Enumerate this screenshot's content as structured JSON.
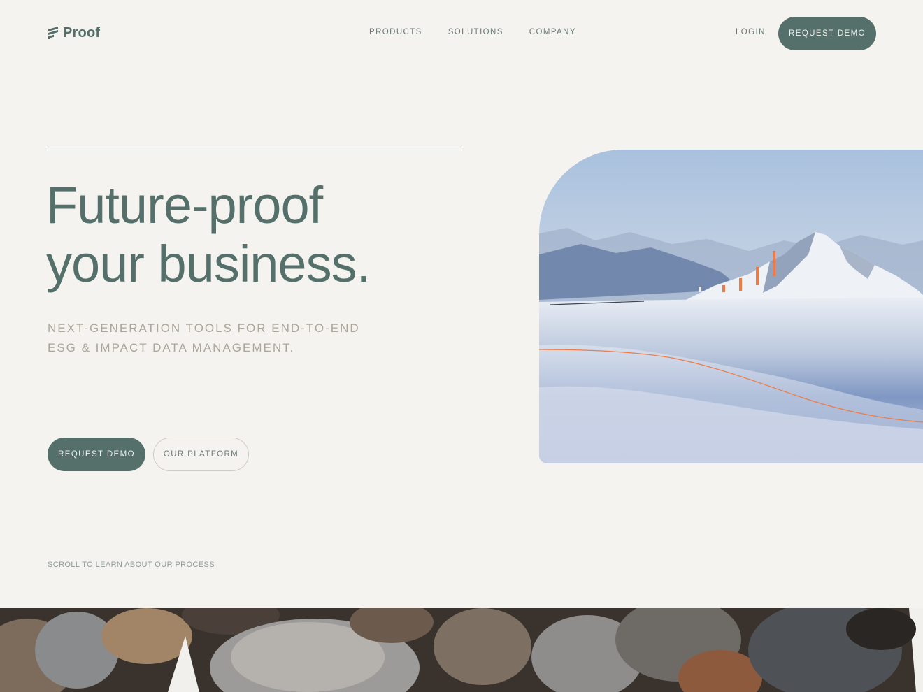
{
  "header": {
    "logo_text": "Proof",
    "nav": [
      "PRODUCTS",
      "SOLUTIONS",
      "COMPANY"
    ],
    "login": "LOGIN",
    "cta": "REQUEST DEMO"
  },
  "hero": {
    "title_line1": "Future-proof",
    "title_line2": "your business.",
    "subtitle_line1": "NEXT-GENERATION TOOLS FOR END-TO-END",
    "subtitle_line2": "ESG & IMPACT DATA MANAGEMENT.",
    "primary_cta": "REQUEST DEMO",
    "secondary_cta": "OUR PLATFORM",
    "scroll_hint": "SCROLL TO LEARN ABOUT OUR PROCESS"
  },
  "colors": {
    "background": "#f5f3ef",
    "brand_green": "#55706a",
    "accent_orange": "#f07a45",
    "muted_text": "#aba59a"
  },
  "icons": {
    "logo": "proof-logo-icon"
  }
}
